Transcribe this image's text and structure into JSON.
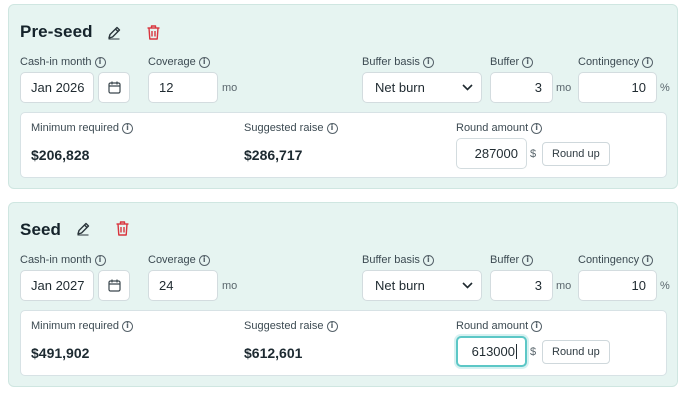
{
  "labels": {
    "cash_in_month": "Cash-in month",
    "coverage": "Coverage",
    "buffer_basis": "Buffer basis",
    "buffer": "Buffer",
    "contingency": "Contingency",
    "minimum_required": "Minimum required",
    "suggested_raise": "Suggested raise",
    "round_amount": "Round amount",
    "info_glyph": "i"
  },
  "units": {
    "months": "mo",
    "percent": "%",
    "dollar": "$"
  },
  "icons": {
    "edit": "pencil-icon",
    "delete": "trash-icon",
    "calendar": "calendar-icon",
    "dropdown": "chevron-down-icon",
    "info": "info-icon"
  },
  "colors": {
    "card_bg": "#e6f4f1",
    "delete_icon": "#d9343d",
    "focus_border": "#5cc7c6"
  },
  "rounds": [
    {
      "title": "Pre-seed",
      "cash_in_month": "Jan 2026",
      "coverage": "12",
      "buffer_basis": "Net burn",
      "buffer": "3",
      "contingency": "10",
      "minimum_required": "$206,828",
      "suggested_raise": "$286,717",
      "round_amount": "287000",
      "round_up_label": "Round up",
      "round_amount_focused": false
    },
    {
      "title": "Seed",
      "cash_in_month": "Jan 2027",
      "coverage": "24",
      "buffer_basis": "Net burn",
      "buffer": "3",
      "contingency": "10",
      "minimum_required": "$491,902",
      "suggested_raise": "$612,601",
      "round_amount": "613000",
      "round_up_label": "Round up",
      "round_amount_focused": true
    }
  ]
}
